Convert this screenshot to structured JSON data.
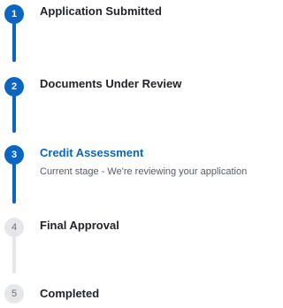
{
  "steps": [
    {
      "number": "1",
      "title": "Application Submitted",
      "status": "done"
    },
    {
      "number": "2",
      "title": "Documents Under Review",
      "status": "done"
    },
    {
      "number": "3",
      "title": "Credit Assessment",
      "status": "current",
      "description": "Current stage - We're reviewing your application"
    },
    {
      "number": "4",
      "title": "Final Approval",
      "status": "pending"
    },
    {
      "number": "5",
      "title": "Completed",
      "status": "pending"
    }
  ],
  "colors": {
    "accent": "#0a66c2",
    "pending_marker": "#e6e7ea",
    "pending_line": "#e4e6e9"
  }
}
